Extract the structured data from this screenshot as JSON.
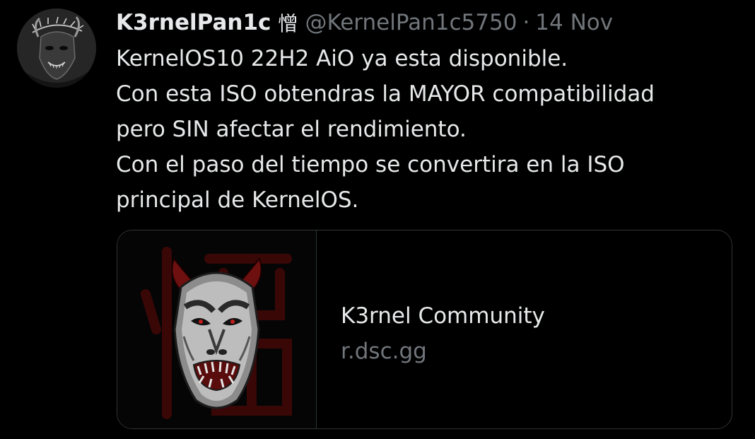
{
  "tweet": {
    "author": {
      "display_name": "K3rnelPan1c",
      "name_emoji": "憎",
      "handle": "@KernelPan1c5750"
    },
    "separator": "·",
    "date": "14 Nov",
    "lines": [
      "KernelOS10 22H2 AiO ya esta disponible.",
      "Con esta ISO obtendras la MAYOR compatibilidad",
      "pero SIN afectar el rendimiento.",
      "Con el paso del tiempo se convertira en la ISO",
      "principal de KernelOS."
    ],
    "link_card": {
      "title": "K3rnel Community",
      "domain": "r.dsc.gg",
      "image_icon": "oni-mask-image"
    }
  },
  "colors": {
    "background": "#000000",
    "text_primary": "#e7e9ea",
    "text_secondary": "#71767b",
    "border": "#2f3336",
    "mask_accent": "#8b1a1a"
  }
}
